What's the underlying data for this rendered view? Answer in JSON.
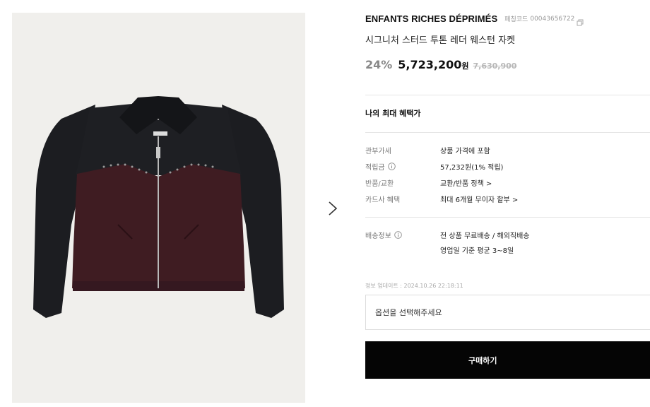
{
  "product": {
    "image_alt": "jacket-photo",
    "brand": "ENFANTS RICHES DÉPRIMÉS",
    "code_label": "페칭코드",
    "code_value": "00043656722",
    "name": "시그니처 스터드 투톤 레더 웨스턴 자켓",
    "discount": "24%",
    "price": "5,723,200",
    "currency": "원",
    "original_price": "7,630,900"
  },
  "benefits": {
    "title": "나의 최대 혜택가",
    "rows": [
      {
        "key": "관부가세",
        "value": "상품 가격에 포함"
      },
      {
        "key": "적립금",
        "value": "57,232원(1% 적립)"
      },
      {
        "key": "반품/교환",
        "value": "교환/반품 정책 >"
      },
      {
        "key": "카드사 혜택",
        "value": "최대 6개월 무이자 할부 >"
      }
    ]
  },
  "shipping": {
    "key": "배송정보",
    "line1": "전 상품 무료배송 / 해외직배송",
    "line2": "영업일 기준 평균 3~8일"
  },
  "update_note": "정보 업데이트 : 2024.10.26 22:18:11",
  "option_placeholder": "옵션을 선택해주세요",
  "buy_label": "구매하기",
  "colors": {
    "leather_black": "#1c1d21",
    "leather_burgundy": "#3f1c22",
    "image_bg": "#f0efec",
    "button_bg": "#050505"
  }
}
